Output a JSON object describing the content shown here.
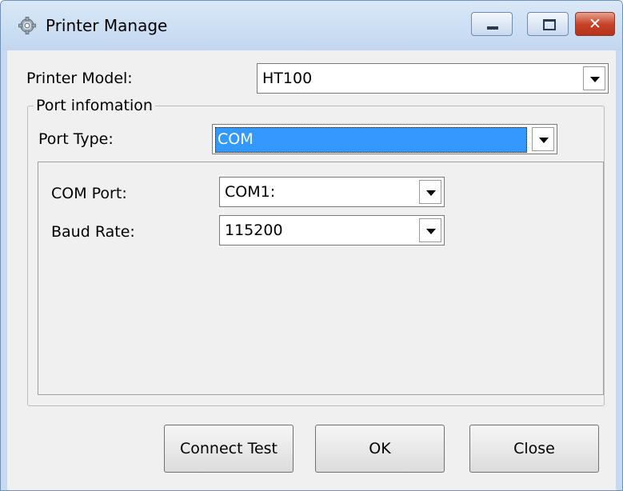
{
  "window": {
    "title": "Printer Manage",
    "icon": "gear-icon",
    "controls": {
      "minimize_icon": "minimize-icon",
      "maximize_icon": "maximize-icon",
      "close_icon": "close-icon"
    }
  },
  "printer_model": {
    "label": "Printer Model:",
    "value": "HT100"
  },
  "port_group": {
    "title": "Port infomation",
    "port_type": {
      "label": "Port Type:",
      "value": "COM",
      "selected_color": "#3399ff"
    },
    "com_port": {
      "label": "COM Port:",
      "value": "COM1:"
    },
    "baud_rate": {
      "label": "Baud Rate:",
      "value": "115200"
    }
  },
  "buttons": {
    "connect_test": "Connect Test",
    "ok": "OK",
    "close": "Close"
  },
  "colors": {
    "titlebar": "#c7daf0",
    "close_button": "#c7442a",
    "client": "#f0f0f0"
  }
}
